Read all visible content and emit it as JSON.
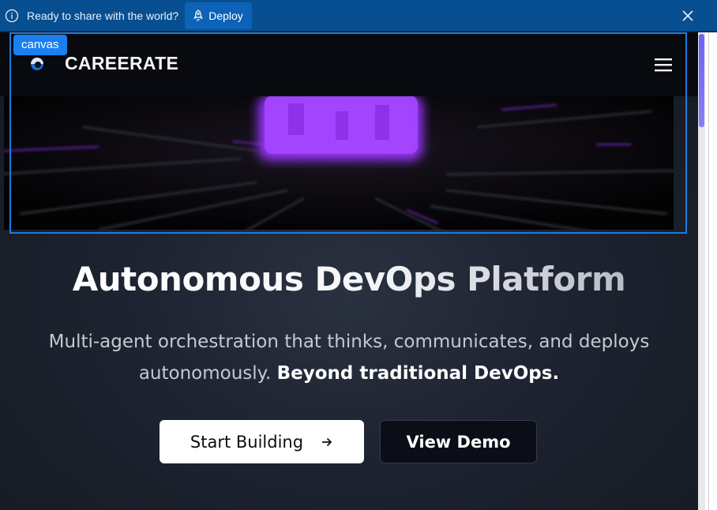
{
  "notification": {
    "message": "Ready to share with the world?",
    "deploy_label": "Deploy"
  },
  "header": {
    "brand": "CAREERATE"
  },
  "canvas": {
    "tag": "canvas"
  },
  "hero": {
    "title": "Autonomous DevOps Platform",
    "subtitle": "Multi-agent orchestration that thinks, communicates, and deploys autonomously.",
    "subtitle_bold": "Beyond traditional DevOps.",
    "primary_button": "Start Building",
    "secondary_button": "View Demo"
  },
  "icons": {
    "info": "info-icon",
    "deploy": "rocket-icon",
    "close": "close-icon",
    "logo": "logo-icon",
    "menu": "menu-icon",
    "arrow": "arrow-right-icon"
  },
  "colors": {
    "notification_bg": "#074f91",
    "deploy_button": "#0d63b8",
    "canvas_outline": "#1c7be0",
    "canvas_tag": "#1a7ff0",
    "glow_purple": "#9a36ff",
    "scroll_thumb": "#7a6ff8"
  }
}
